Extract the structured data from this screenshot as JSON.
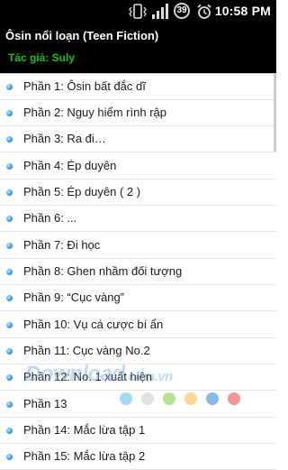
{
  "status_bar": {
    "time": "10:58 PM",
    "notification_count": "39",
    "icons": [
      "vibrate-icon",
      "signal-icon",
      "battery-icon",
      "alarm-icon"
    ]
  },
  "header": {
    "title": "Ôsin nổi loạn (Teen Fiction)",
    "author": "Tác giả: Suly"
  },
  "chapters": [
    "Phần 1: Ôsin bất đắc dĩ",
    "Phần 2: Nguy hiểm rình rập",
    "Phần 3: Ra đi…",
    "Phần 4: Ép duyên",
    "Phần 5: Ép duyên ( 2 )",
    "Phần 6: ...",
    "Phần 7: Đi học",
    "Phần 8: Ghen nhầm đối tượng",
    "Phần 9: “Cục vàng”",
    "Phần 10: Vụ cá cược bí ẩn",
    "Phần 11: Cục vàng No.2",
    "Phần 12: No. 1 xuất hiện",
    "Phần 13",
    "Phần 14: Mắc lừa tập 1",
    "Phần 15: Mắc lừa tập 2"
  ],
  "watermark": {
    "text": "Download",
    "suffix": ".com.vn"
  },
  "colors": {
    "author": "#17c217",
    "bullet": "#3a9ee6",
    "dots": [
      "#8fd0f2",
      "#d8d8d8",
      "#a8d880",
      "#f5cf7a",
      "#6aa7e2",
      "#ee7a7a"
    ]
  }
}
